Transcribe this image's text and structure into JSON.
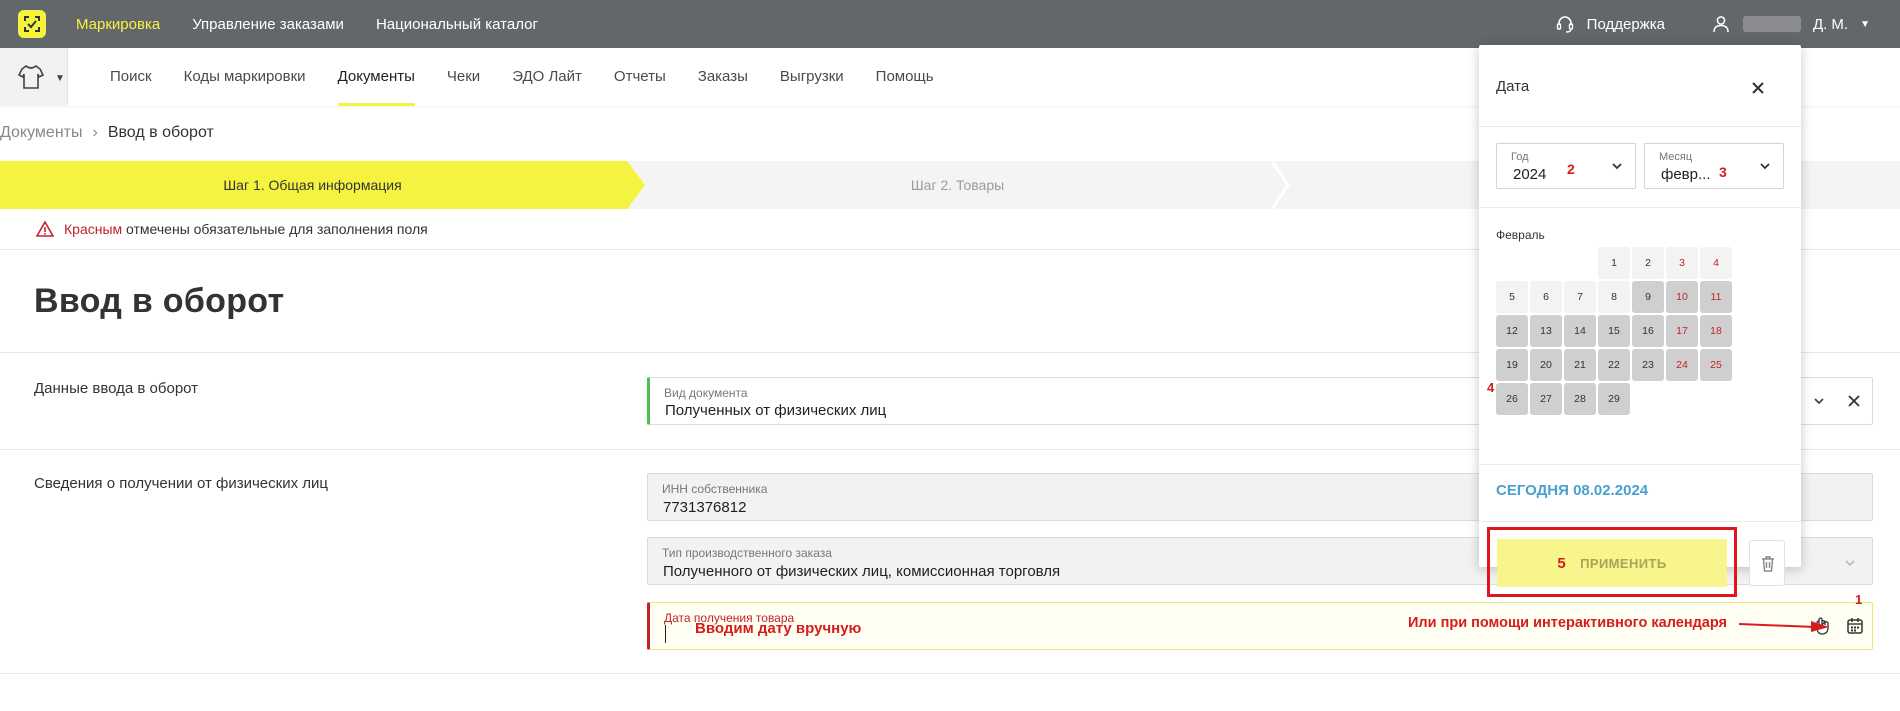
{
  "topbar": {
    "nav": [
      "Маркировка",
      "Управление заказами",
      "Национальный каталог"
    ],
    "support": "Поддержка",
    "user_suffix": "Д. М."
  },
  "subnav": {
    "items": [
      "Поиск",
      "Коды маркировки",
      "Документы",
      "Чеки",
      "ЭДО Лайт",
      "Отчеты",
      "Заказы",
      "Выгрузки",
      "Помощь"
    ],
    "active": "Документы"
  },
  "breadcrumb": {
    "parent": "Документы",
    "current": "Ввод в оборот"
  },
  "steps": {
    "step1": "Шаг 1. Общая информация",
    "step2": "Шаг 2. Товары"
  },
  "warning": {
    "red_word": "Красным",
    "rest": " отмечены обязательные для заполнения поля"
  },
  "page_title": "Ввод в оборот",
  "sections": {
    "entry": {
      "label": "Данные ввода в оборот",
      "doc_type_label": "Вид документа",
      "doc_type_value": "Полученных от физических лиц"
    },
    "info": {
      "label": "Сведения о получении от физических лиц",
      "inn_label": "ИНН собственника",
      "inn_value": "7731376812",
      "order_type_label": "Тип производственного заказа",
      "order_type_value": "Полученного от физических лиц, комиссионная торговля",
      "date_label": "Дата получения товара",
      "date_value": ""
    }
  },
  "calendar": {
    "title": "Дата",
    "year_label": "Год",
    "year_value": "2024",
    "month_label": "Месяц",
    "month_value": "февр...",
    "month_name": "Февраль",
    "days": [
      "1",
      "2",
      "3",
      "4",
      "5",
      "6",
      "7",
      "8",
      "9",
      "10",
      "11",
      "12",
      "13",
      "14",
      "15",
      "16",
      "17",
      "18",
      "19",
      "20",
      "21",
      "22",
      "23",
      "24",
      "25",
      "26",
      "27",
      "28",
      "29"
    ],
    "today_text": "СЕГОДНЯ 08.02.2024",
    "apply_label": "ПРИМЕНИТЬ"
  },
  "annotations": {
    "manual": "Вводим дату вручную",
    "calendar_hint": "Или при помощи интерактивного календаря",
    "n1": "1",
    "n2": "2",
    "n3": "3",
    "n4": "4",
    "n5": "5"
  },
  "colors": {
    "brand_yellow": "#f4f440",
    "topbar": "#63666a",
    "required_red": "#c4222a",
    "annotation_red": "#e0161c",
    "link_blue": "#4a9fd0"
  }
}
